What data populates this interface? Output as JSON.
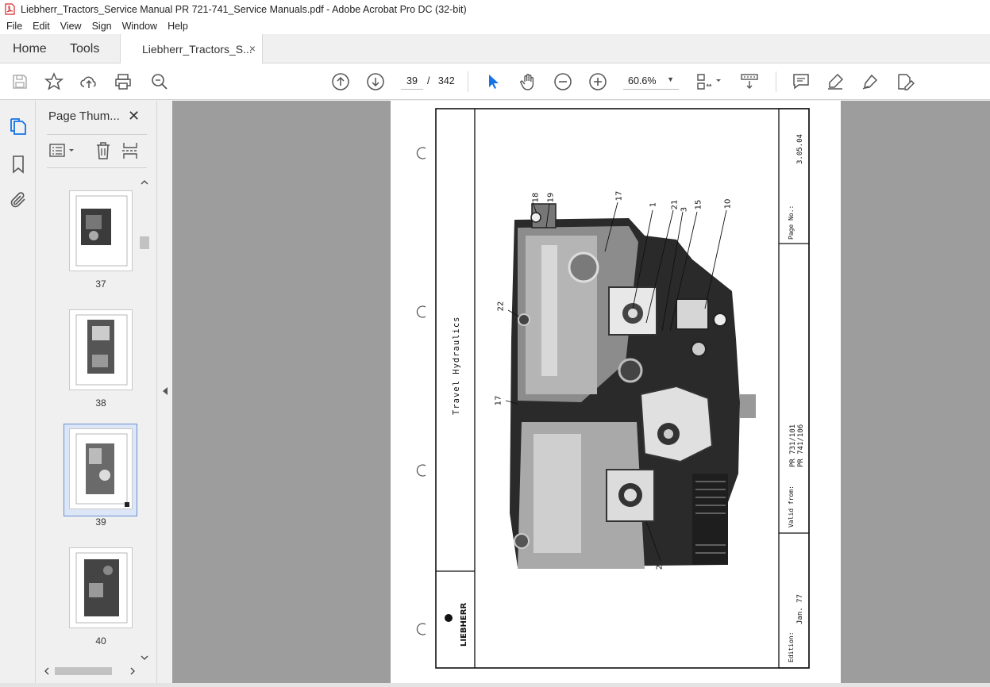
{
  "window": {
    "title": "Liebherr_Tractors_Service Manual PR 721-741_Service Manuals.pdf - Adobe Acrobat Pro DC (32-bit)"
  },
  "menu": [
    "File",
    "Edit",
    "View",
    "Sign",
    "Window",
    "Help"
  ],
  "tabs": {
    "home": "Home",
    "tools": "Tools",
    "document": "Liebherr_Tractors_S...",
    "close": "×"
  },
  "toolbar": {
    "page_current": "39",
    "page_separator": "/",
    "page_total": "342",
    "zoom": "60.6%"
  },
  "panel": {
    "title": "Page Thum...",
    "close": "✕",
    "thumbnails": [
      {
        "label": "37"
      },
      {
        "label": "38"
      },
      {
        "label": "39",
        "selected": true
      },
      {
        "label": "40"
      }
    ]
  },
  "document": {
    "section_title": "Travel Hydraulics",
    "page_no_label": "Page No.:",
    "page_no": "3.05.04",
    "valid_from_label": "Valid from:",
    "models": [
      "PR 731/101",
      "PR 741/106"
    ],
    "edition_label": "Edition:",
    "edition": "Jan. 77",
    "brand": "LIEBHERR",
    "callouts": [
      "18",
      "19",
      "17",
      "1",
      "21",
      "3",
      "15",
      "10",
      "22",
      "17",
      "2"
    ]
  },
  "colors": {
    "accent": "#1473e6",
    "doc_background": "#9d9d9d",
    "pdf_red": "#d4272b"
  }
}
